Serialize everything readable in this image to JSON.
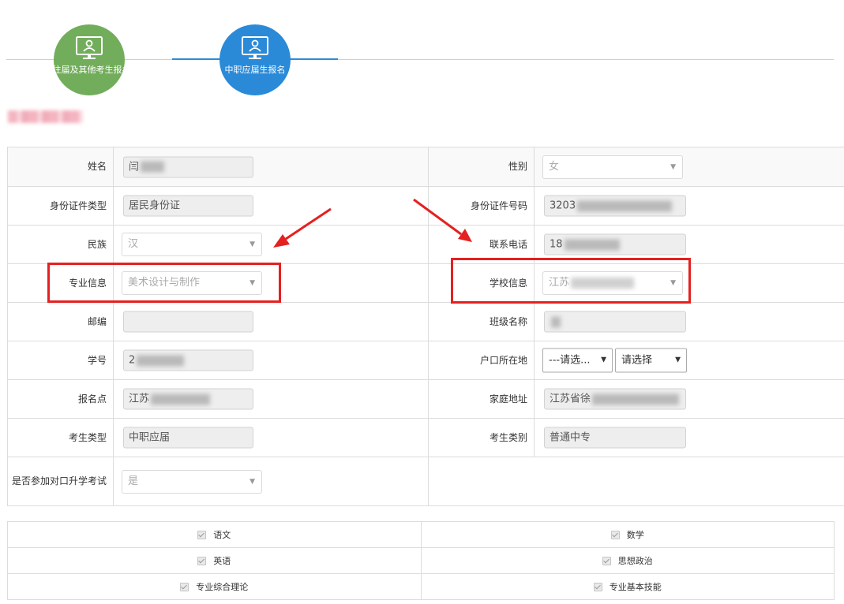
{
  "steps": [
    {
      "label": "往届及其他考生报名",
      "state": "done",
      "color": "#72ad5b",
      "icon": "monitor-user-icon"
    },
    {
      "label": "中职应届生报名",
      "state": "active",
      "color": "#2a8ad8",
      "icon": "monitor-user-icon"
    }
  ],
  "form": {
    "name": {
      "label": "姓名",
      "value": "闫"
    },
    "gender": {
      "label": "性别",
      "value": "女"
    },
    "id_type": {
      "label": "身份证件类型",
      "value": "居民身份证"
    },
    "id_number": {
      "label": "身份证件号码",
      "value": "3203"
    },
    "ethnicity": {
      "label": "民族",
      "value": "汉"
    },
    "phone": {
      "label": "联系电话",
      "value": "18"
    },
    "major": {
      "label": "专业信息",
      "value": "美术设计与制作"
    },
    "school": {
      "label": "学校信息",
      "value": "江苏"
    },
    "postcode": {
      "label": "邮编",
      "value": ""
    },
    "class_name": {
      "label": "班级名称",
      "value": ""
    },
    "student_no": {
      "label": "学号",
      "value": "2"
    },
    "household": {
      "label": "户口所在地",
      "province": "---请选...",
      "city": "请选择"
    },
    "exam_site": {
      "label": "报名点",
      "value": "江苏"
    },
    "home_address": {
      "label": "家庭地址",
      "value": "江苏省徐"
    },
    "candidate_type": {
      "label": "考生类型",
      "value": "中职应届"
    },
    "candidate_category": {
      "label": "考生类别",
      "value": "普通中专"
    },
    "vocational_exam": {
      "label": "是否参加对口升学考试",
      "value": "是"
    }
  },
  "subjects": [
    [
      "语文",
      "数学"
    ],
    [
      "英语",
      "思想政治"
    ],
    [
      "专业综合理论",
      "专业基本技能"
    ]
  ],
  "annotation_color": "#e52020"
}
